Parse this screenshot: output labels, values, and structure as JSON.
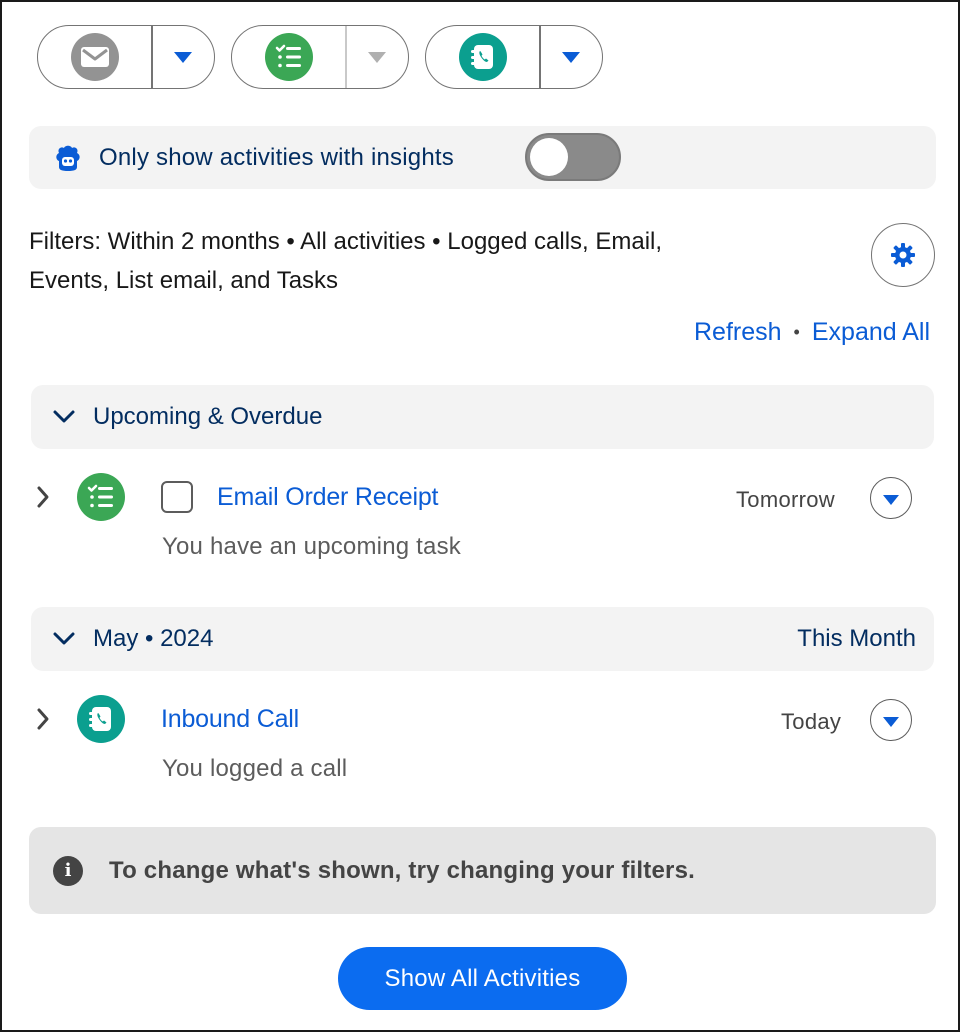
{
  "actions": {
    "email": {
      "icon": "envelope-icon",
      "color": "#939393"
    },
    "task": {
      "icon": "task-list-icon",
      "color": "#3ba755"
    },
    "call": {
      "icon": "phone-book-icon",
      "color": "#0b9f8f"
    }
  },
  "insights": {
    "label": "Only show activities with insights",
    "enabled": false
  },
  "filters": {
    "text_line1": "Filters: Within 2 months • All activities • Logged calls, Email,",
    "text_line2": "Events, List email, and Tasks"
  },
  "links": {
    "refresh": "Refresh",
    "separator": "•",
    "expand_all": "Expand All"
  },
  "sections": [
    {
      "title": "Upcoming & Overdue",
      "right_label": "",
      "items": [
        {
          "icon": "task-list-icon",
          "title": "Email Order Receipt",
          "subtitle": "You have an upcoming task",
          "date": "Tomorrow",
          "has_checkbox": true
        }
      ]
    },
    {
      "title": "May • 2024",
      "right_label": "This Month",
      "items": [
        {
          "icon": "phone-book-icon",
          "title": "Inbound Call",
          "subtitle": "You logged a call",
          "date": "Today",
          "has_checkbox": false
        }
      ]
    }
  ],
  "info": {
    "text": "To change what's shown, try changing your filters."
  },
  "show_all_button": "Show All Activities",
  "colors": {
    "link_blue": "#0b5cd5",
    "brand_blue": "#0b6cf0",
    "navy_text": "#032d60",
    "task_green": "#3ba755",
    "call_teal": "#0b9f8f"
  }
}
